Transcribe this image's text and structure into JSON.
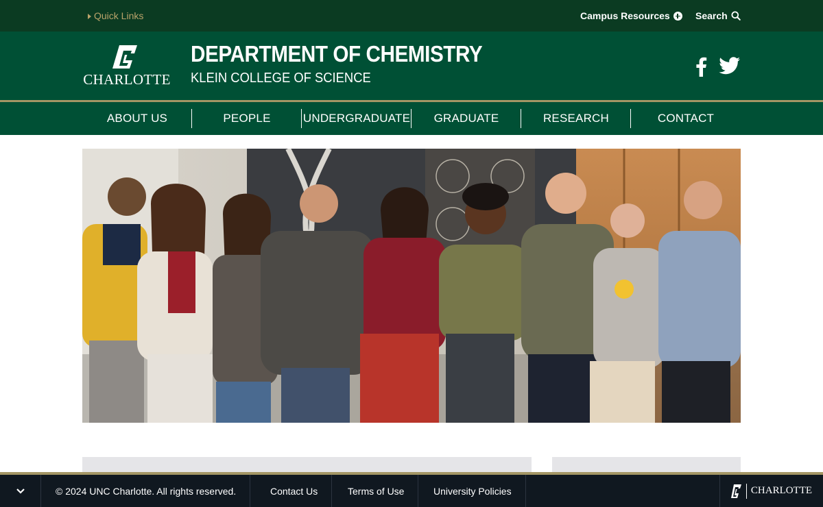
{
  "utility": {
    "quick_links": "Quick Links",
    "campus_resources": "Campus Resources",
    "search": "Search"
  },
  "header": {
    "logo_text": "CHARLOTTE",
    "title": "DEPARTMENT OF CHEMISTRY",
    "subtitle": "KLEIN COLLEGE OF SCIENCE",
    "social": [
      "facebook-icon",
      "twitter-icon"
    ]
  },
  "nav": {
    "items": [
      "ABOUT US",
      "PEOPLE",
      "UNDERGRADUATE",
      "GRADUATE",
      "RESEARCH",
      "CONTACT"
    ]
  },
  "footer": {
    "copyright": "© 2024 UNC Charlotte. All rights reserved.",
    "links": [
      "Contact Us",
      "Terms of Use",
      "University Policies"
    ],
    "logo_text": "CHARLOTTE"
  },
  "colors": {
    "utility_bg": "#0b3b22",
    "brand_green": "#005035",
    "gold": "#a49665",
    "footer_bg": "#101820"
  }
}
